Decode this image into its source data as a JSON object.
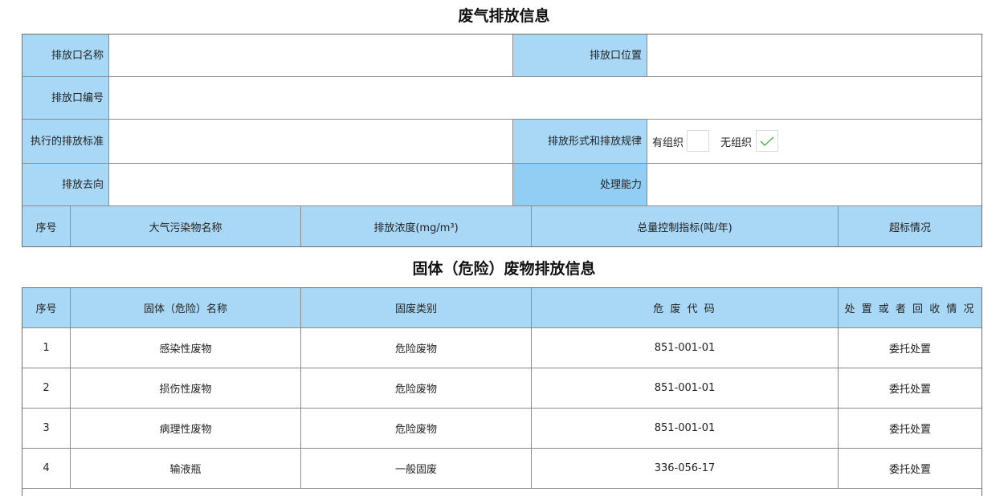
{
  "air": {
    "title": "废气排放信息",
    "labels": {
      "outlet_name": "排放口名称",
      "outlet_location": "排放口位置",
      "outlet_code": "排放口编号",
      "standard": "执行的排放标准",
      "emission_form": "排放形式和排放规律",
      "destination": "排放去向",
      "capacity": "处理能力"
    },
    "values": {
      "outlet_name": "",
      "outlet_location": "",
      "outlet_code": "",
      "standard": "",
      "destination": "",
      "capacity": ""
    },
    "options": {
      "organized": {
        "label": "有组织",
        "checked": false
      },
      "unorganized": {
        "label": "无组织",
        "checked": true
      }
    },
    "table_headers": [
      "序号",
      "大气污染物名称",
      "排放浓度(mg/m³)",
      "总量控制指标(吨/年)",
      "超标情况"
    ]
  },
  "solid": {
    "title": "固体（危险）废物排放信息",
    "headers": [
      "序号",
      "固体（危险）名称",
      "固废类别",
      "危 废 代 码",
      "处 置 或 者 回 收 情 况"
    ],
    "rows": [
      {
        "no": "1",
        "name": "感染性废物",
        "category": "危险废物",
        "code": "851-001-01",
        "disposal": "委托处置"
      },
      {
        "no": "2",
        "name": "损伤性废物",
        "category": "危险废物",
        "code": "851-001-01",
        "disposal": "委托处置"
      },
      {
        "no": "3",
        "name": "病理性废物",
        "category": "危险废物",
        "code": "851-001-01",
        "disposal": "委托处置"
      },
      {
        "no": "4",
        "name": "输液瓶",
        "category": "一般固废",
        "code": "336-056-17",
        "disposal": "委托处置"
      }
    ]
  },
  "colors": {
    "label_bg": "#a9d8f6",
    "label_bg_dark": "#92cdf4",
    "border": "#8c8c8c",
    "check": "#4caf50"
  },
  "icons": {
    "checkmark": "checkmark-icon"
  }
}
